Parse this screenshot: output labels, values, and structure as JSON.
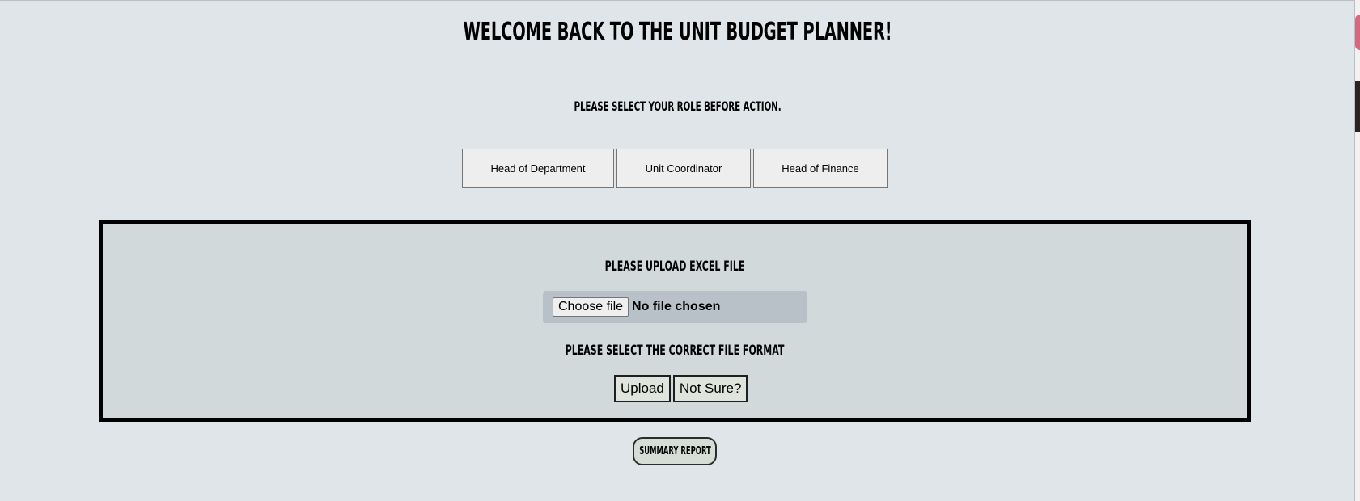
{
  "header": {
    "title": "WELCOME BACK TO THE UNIT BUDGET PLANNER!",
    "role_prompt": "PLEASE SELECT YOUR ROLE BEFORE ACTION."
  },
  "roles": [
    {
      "label": "Head of Department"
    },
    {
      "label": "Unit Coordinator"
    },
    {
      "label": "Head of Finance"
    }
  ],
  "upload": {
    "heading": "PLEASE UPLOAD EXCEL FILE",
    "choose_file_label": "Choose file",
    "file_status": "No file chosen",
    "format_heading": "PLEASE SELECT THE CORRECT FILE FORMAT",
    "upload_label": "Upload",
    "not_sure_label": "Not Sure?"
  },
  "footer": {
    "summary_report_label": "SUMMARY REPORT"
  },
  "colors": {
    "page_background": "#dfe5e8",
    "panel_background": "#d1d9db",
    "file_box_background": "#b9c1c8"
  }
}
